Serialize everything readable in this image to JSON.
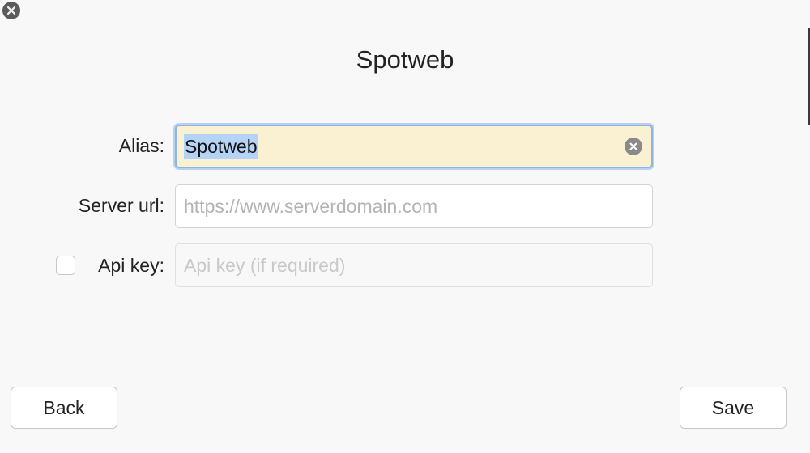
{
  "dialog": {
    "title": "Spotweb"
  },
  "form": {
    "alias": {
      "label": "Alias:",
      "value": "Spotweb"
    },
    "server_url": {
      "label": "Server url:",
      "value": "",
      "placeholder": "https://www.serverdomain.com"
    },
    "api_key": {
      "label": "Api key:",
      "value": "",
      "placeholder": "Api key (if required)",
      "enabled": false
    }
  },
  "buttons": {
    "back_label": "Back",
    "save_label": "Save"
  },
  "icons": {
    "close": "close-icon",
    "clear": "clear-field-icon"
  },
  "colors": {
    "focused_field_bg": "#faf0d2",
    "focus_ring": "#8fb4e3",
    "selection": "#b5d3f7"
  }
}
